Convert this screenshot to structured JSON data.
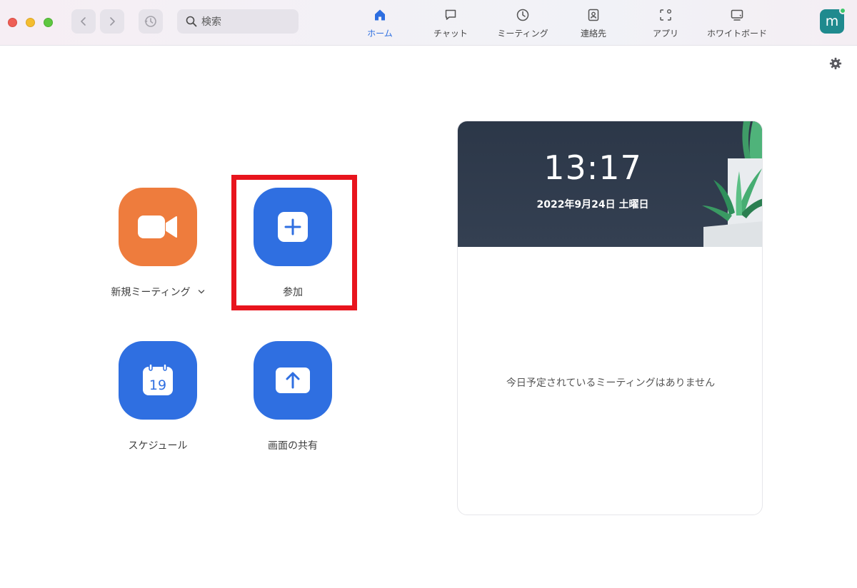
{
  "window": {
    "search_placeholder": "検索"
  },
  "tabs": [
    {
      "label": "ホーム",
      "icon": "home-icon",
      "active": true
    },
    {
      "label": "チャット",
      "icon": "chat-icon",
      "active": false
    },
    {
      "label": "ミーティング",
      "icon": "clock-icon",
      "active": false
    },
    {
      "label": "連絡先",
      "icon": "contacts-icon",
      "active": false
    },
    {
      "label": "アプリ",
      "icon": "apps-icon",
      "active": false
    },
    {
      "label": "ホワイトボード",
      "icon": "whiteboard-icon",
      "active": false
    }
  ],
  "user": {
    "avatar_initial": "m",
    "status": "online"
  },
  "actions": {
    "new_meeting": {
      "label": "新規ミーティング",
      "icon": "video-camera-icon",
      "color": "#ee7c3d"
    },
    "join": {
      "label": "参加",
      "icon": "plus-icon",
      "color": "#2f6fe1",
      "highlighted": true
    },
    "schedule": {
      "label": "スケジュール",
      "icon": "calendar-icon",
      "calendar_day": "19",
      "color": "#2f6fe1"
    },
    "share_screen": {
      "label": "画面の共有",
      "icon": "share-up-arrow-icon",
      "color": "#2f6fe1"
    }
  },
  "calendar_card": {
    "time": "13:17",
    "date": "2022年9月24日 土曜日",
    "empty_message": "今日予定されているミーティングはありません"
  },
  "colors": {
    "accent": "#2d6ee0",
    "highlight": "#e8141d"
  }
}
